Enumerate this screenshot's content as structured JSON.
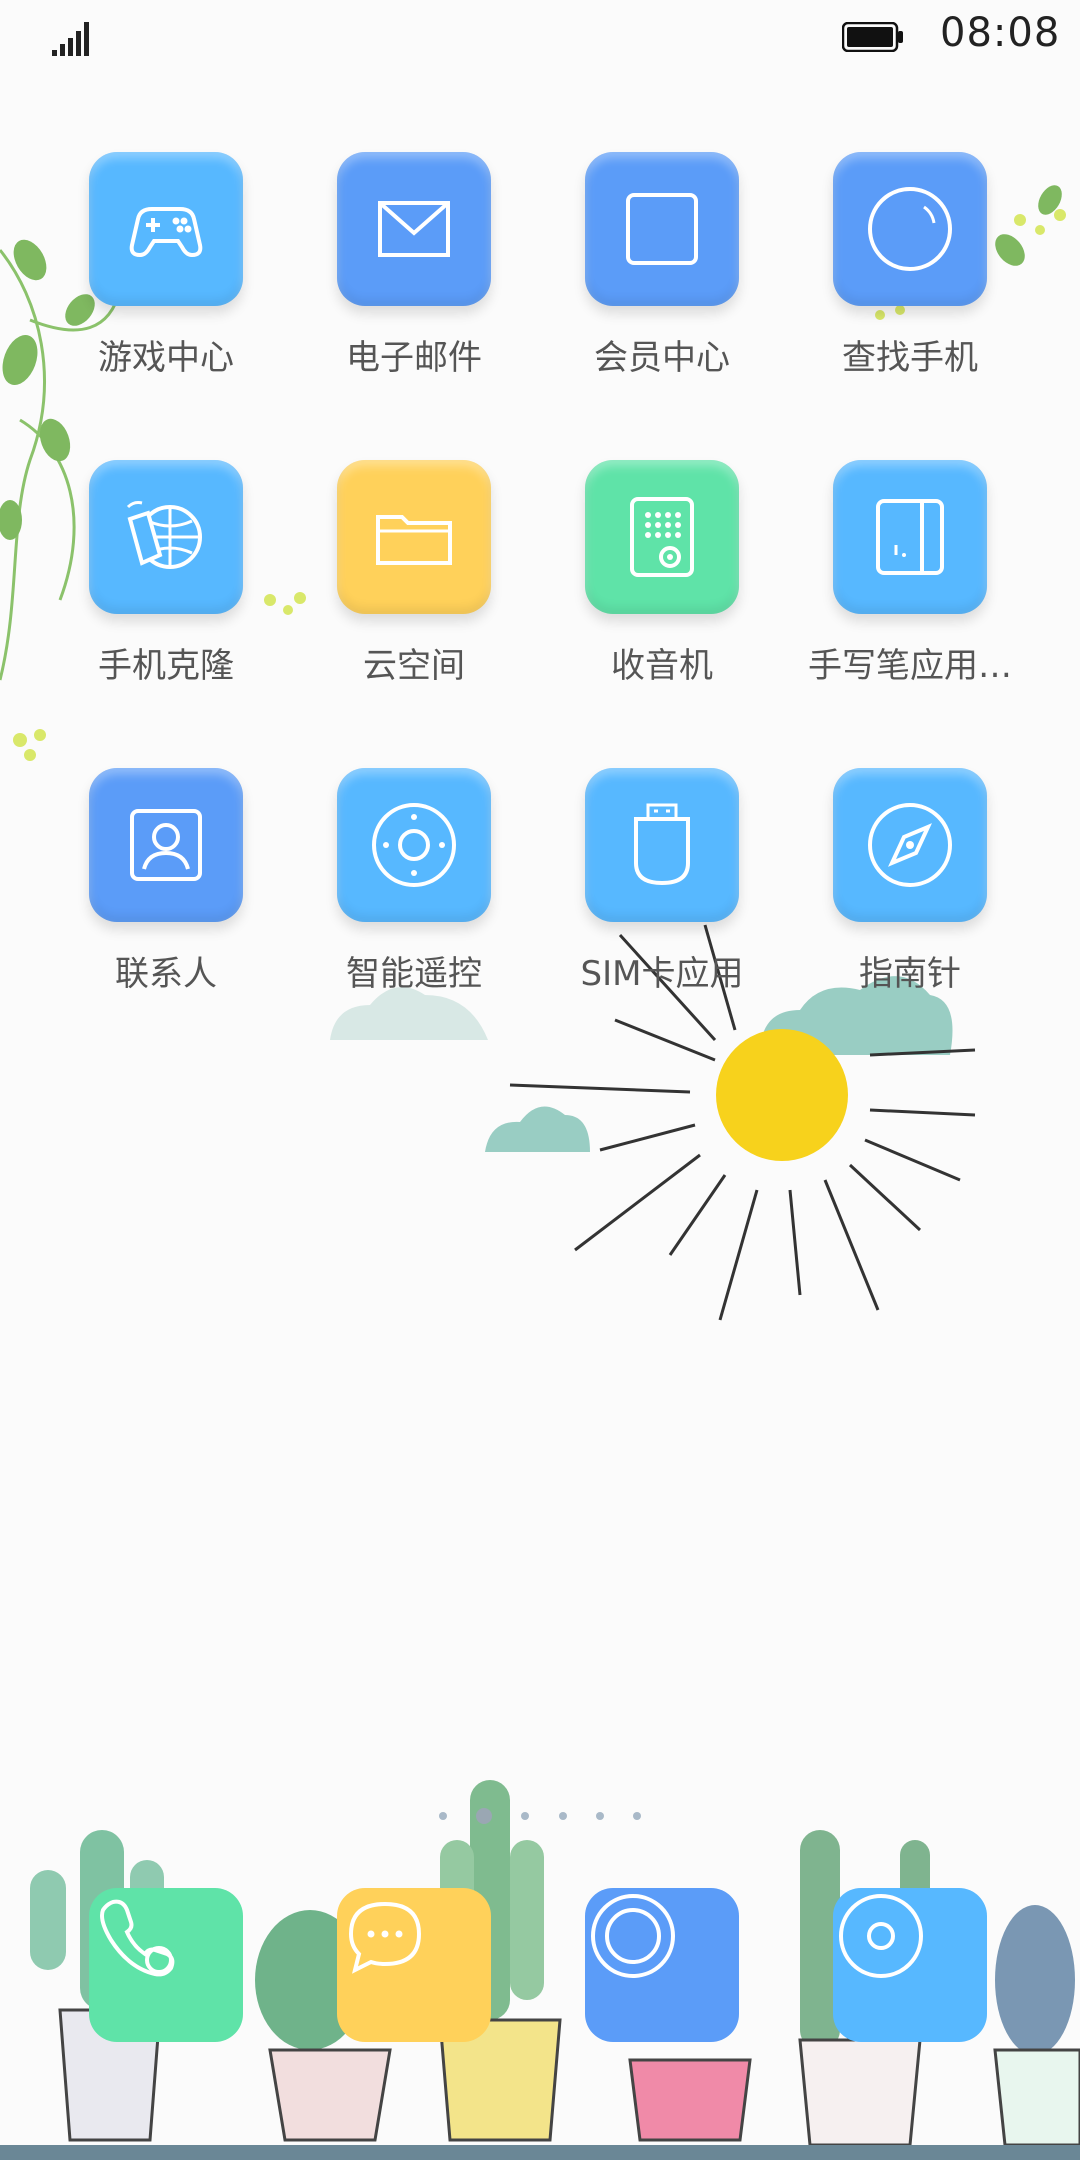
{
  "status_bar": {
    "time": "08:08"
  },
  "apps": [
    {
      "label": "游戏中心",
      "icon": "gamepad-icon",
      "color": "#57b8ff"
    },
    {
      "label": "电子邮件",
      "icon": "mail-icon",
      "color": "#5b9cf8"
    },
    {
      "label": "会员中心",
      "icon": "square-icon",
      "color": "#5b9cf8"
    },
    {
      "label": "查找手机",
      "icon": "circle-icon",
      "color": "#5b9cf8"
    },
    {
      "label": "手机克隆",
      "icon": "clone-icon",
      "color": "#57b8ff"
    },
    {
      "label": "云空间",
      "icon": "folder-icon",
      "color": "#ffd15a"
    },
    {
      "label": "收音机",
      "icon": "radio-icon",
      "color": "#5fe3a8"
    },
    {
      "label": "手写笔应用…",
      "icon": "stylus-app-icon",
      "color": "#57b8ff"
    },
    {
      "label": "联系人",
      "icon": "contact-icon",
      "color": "#5b9cf8"
    },
    {
      "label": "智能遥控",
      "icon": "remote-icon",
      "color": "#57b8ff"
    },
    {
      "label": "SIM卡应用",
      "icon": "sim-card-icon",
      "color": "#57b8ff"
    },
    {
      "label": "指南针",
      "icon": "compass-icon",
      "color": "#57b8ff"
    }
  ],
  "dock": [
    {
      "icon": "phone-icon",
      "color": "#5fe3a8"
    },
    {
      "icon": "message-icon",
      "color": "#ffd15a"
    },
    {
      "icon": "browser-icon",
      "color": "#5b9cf8"
    },
    {
      "icon": "music-icon",
      "color": "#57b8ff"
    }
  ],
  "page_indicator": {
    "pages": 6,
    "active": 2
  }
}
